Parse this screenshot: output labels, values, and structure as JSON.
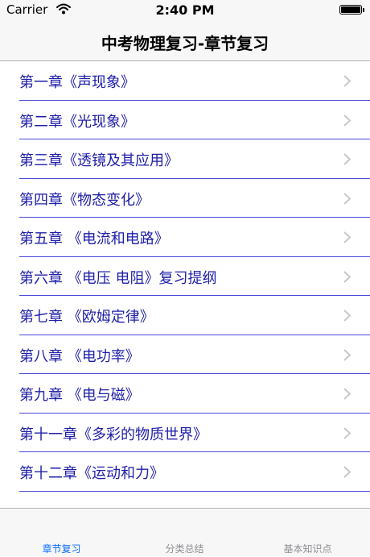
{
  "status_bar": {
    "carrier": "Carrier",
    "time": "2:40 PM"
  },
  "nav": {
    "title": "中考物理复习-章节复习"
  },
  "chapters": [
    "第一章《声现象》",
    "第二章《光现象》",
    "第三章《透镜及其应用》",
    "第四章《物态变化》",
    "第五章 《电流和电路》",
    "第六章 《电压 电阻》复习提纲",
    "第七章 《欧姆定律》",
    "第八章 《电功率》",
    "第九章 《电与磁》",
    "第十一章《多彩的物质世界》",
    "第十二章《运动和力》"
  ],
  "tabs": [
    {
      "label": "章节复习",
      "active": true
    },
    {
      "label": "分类总结",
      "active": false
    },
    {
      "label": "基本知识点",
      "active": false
    }
  ],
  "colors": {
    "row_text": "#1e1ea8",
    "separator": "#4a4ad8",
    "tab_active": "#0a6cff",
    "tab_inactive": "#8e8e93"
  },
  "icons": {
    "row_accessory": "chevron-right-icon",
    "wifi": "wifi-icon",
    "battery": "battery-icon"
  }
}
